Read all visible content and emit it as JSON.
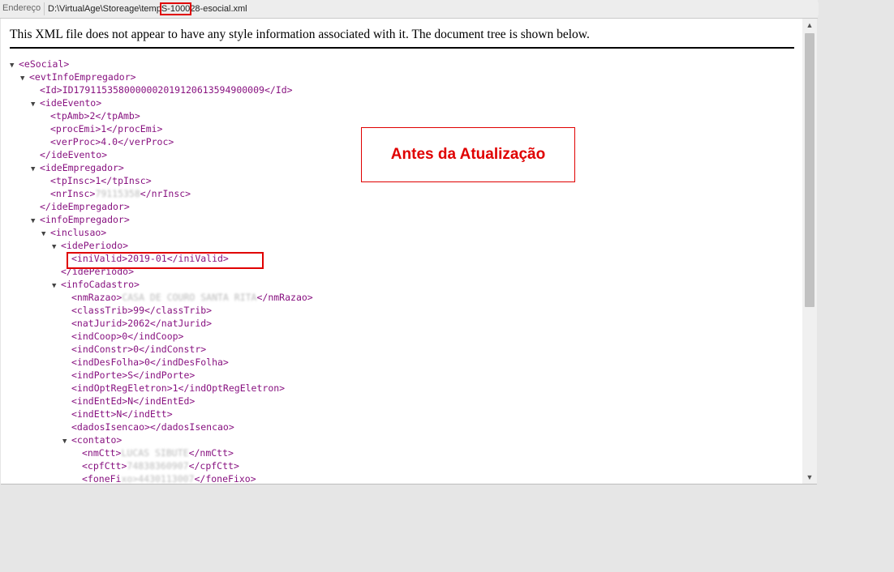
{
  "address_bar": {
    "label": "Endereço",
    "path_prefix": "D:\\VirtualAge\\Storeage\\temp",
    "path_highlight": "S-1000",
    "path_suffix": "28-esocial.xml"
  },
  "notice": "This XML file does not appear to have any style information associated with it. The document tree is shown below.",
  "callout": "Antes da Atualização",
  "xml_lines": [
    {
      "arrow": "▼",
      "text": "<eSocial>"
    },
    {
      "arrow": "▼",
      "text": "<evtInfoEmpregador>"
    },
    {
      "arrow": "",
      "text": "<Id>ID1791153580000002019120613594900009</Id>"
    },
    {
      "arrow": "▼",
      "text": "<ideEvento>"
    },
    {
      "arrow": "",
      "text": "<tpAmb>2</tpAmb>"
    },
    {
      "arrow": "",
      "text": "<procEmi>1</procEmi>"
    },
    {
      "arrow": "",
      "text": "<verProc>4.0</verProc>"
    },
    {
      "arrow": "",
      "text": "</ideEvento>"
    },
    {
      "arrow": "▼",
      "text": "<ideEmpregador>"
    },
    {
      "arrow": "",
      "text": "<tpInsc>1</tpInsc>"
    },
    {
      "arrow": "",
      "text": "<nrInsc>",
      "blur": "79115358",
      "tail": "</nrInsc>"
    },
    {
      "arrow": "",
      "text": "</ideEmpregador>"
    },
    {
      "arrow": "▼",
      "text": "<infoEmpregador>"
    },
    {
      "arrow": "▼",
      "text": "<inclusao>"
    },
    {
      "arrow": "▼",
      "text": "<idePeriodo>"
    },
    {
      "arrow": "",
      "text": "<iniValid>2019-01</iniValid>"
    },
    {
      "arrow": "",
      "text": "</idePeriodo>"
    },
    {
      "arrow": "▼",
      "text": "<infoCadastro>"
    },
    {
      "arrow": "",
      "text": "<nmRazao>",
      "blur": "CASA DE COURO SANTA RITA",
      "tail": "</nmRazao>"
    },
    {
      "arrow": "",
      "text": "<classTrib>99</classTrib>"
    },
    {
      "arrow": "",
      "text": "<natJurid>2062</natJurid>"
    },
    {
      "arrow": "",
      "text": "<indCoop>0</indCoop>"
    },
    {
      "arrow": "",
      "text": "<indConstr>0</indConstr>"
    },
    {
      "arrow": "",
      "text": "<indDesFolha>0</indDesFolha>"
    },
    {
      "arrow": "",
      "text": "<indPorte>S</indPorte>"
    },
    {
      "arrow": "",
      "text": "<indOptRegEletron>1</indOptRegEletron>"
    },
    {
      "arrow": "",
      "text": "<indEntEd>N</indEntEd>"
    },
    {
      "arrow": "",
      "text": "<indEtt>N</indEtt>"
    },
    {
      "arrow": "",
      "text": "<dadosIsencao></dadosIsencao>"
    },
    {
      "arrow": "▼",
      "text": "<contato>"
    },
    {
      "arrow": "",
      "text": "<nmCtt>",
      "blur": "LUCAS SIBUTE",
      "tail": "</nmCtt>"
    },
    {
      "arrow": "",
      "text": "<cpfCtt>",
      "blur": "74838360907",
      "tail": "</cpfCtt>"
    },
    {
      "arrow": "",
      "text": "<foneFi",
      "blur": "xo>4430113007",
      "tail": "</foneFixo>"
    }
  ],
  "colors": {
    "tag": "#881280",
    "highlight": "#e00000"
  }
}
